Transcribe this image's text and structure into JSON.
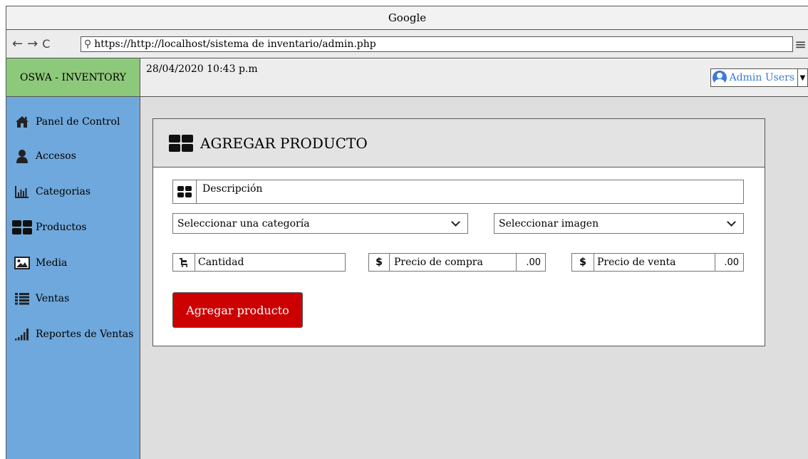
{
  "browser": {
    "title": "Google",
    "url": "https://http://localhost/sistema de inventario/admin.php"
  },
  "app": {
    "brand": "OSWA - INVENTORY",
    "datetime": "28/04/2020 10:43 p.m",
    "user": "Admin Users"
  },
  "sidebar": {
    "items": [
      {
        "label": "Panel de Control",
        "icon": "home-icon"
      },
      {
        "label": "Accesos",
        "icon": "user-icon"
      },
      {
        "label": "Categorias",
        "icon": "bar-chart-icon"
      },
      {
        "label": "Productos",
        "icon": "grid-icon"
      },
      {
        "label": "Media",
        "icon": "image-icon"
      },
      {
        "label": "Ventas",
        "icon": "list-icon"
      },
      {
        "label": "Reportes de Ventas",
        "icon": "signal-icon"
      }
    ]
  },
  "form": {
    "title": "AGREGAR PRODUCTO",
    "description_placeholder": "Descripción",
    "category_select": "Seleccionar una categoría",
    "image_select": "Seleccionar imagen",
    "quantity_placeholder": "Cantidad",
    "currency_symbol": "$",
    "buy_price_placeholder": "Precio de compra",
    "buy_price_suffix": ".00",
    "sell_price_placeholder": "Precio de venta",
    "sell_price_suffix": ".00",
    "submit_label": "Agregar producto"
  },
  "colors": {
    "brand_bg": "#8dc97a",
    "sidebar_bg": "#6fa8dc",
    "submit_bg": "#cc0000",
    "user_link": "#3a7bd5"
  }
}
